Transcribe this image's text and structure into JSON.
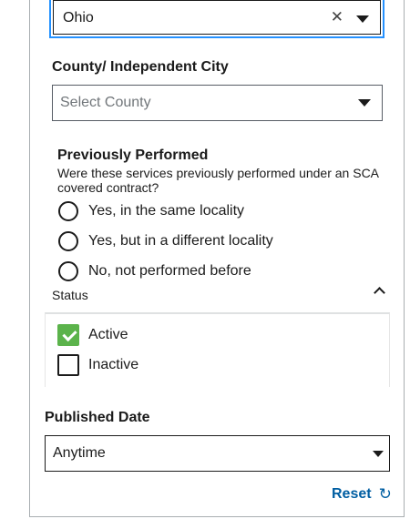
{
  "location": {
    "state_value": "Ohio",
    "clear_icon_glyph": "✕",
    "county_label": "County/ Independent City",
    "county_placeholder": "Select County"
  },
  "previously_performed": {
    "title": "Previously Performed",
    "hint": "Were these services previously performed under an SCA covered contract?",
    "options": [
      {
        "label": "Yes, in the same locality",
        "selected": false
      },
      {
        "label": "Yes, but in a different locality",
        "selected": false
      },
      {
        "label": "No, not performed before",
        "selected": false
      }
    ]
  },
  "status": {
    "label": "Status",
    "options": [
      {
        "label": "Active",
        "checked": true
      },
      {
        "label": "Inactive",
        "checked": false
      }
    ],
    "check_color": "#5bb34b"
  },
  "published_date": {
    "label": "Published Date",
    "value": "Anytime"
  },
  "reset": {
    "label": "Reset",
    "icon_glyph": "↻"
  },
  "colors": {
    "focus_outline": "#2491ff",
    "link": "#005ea2"
  }
}
